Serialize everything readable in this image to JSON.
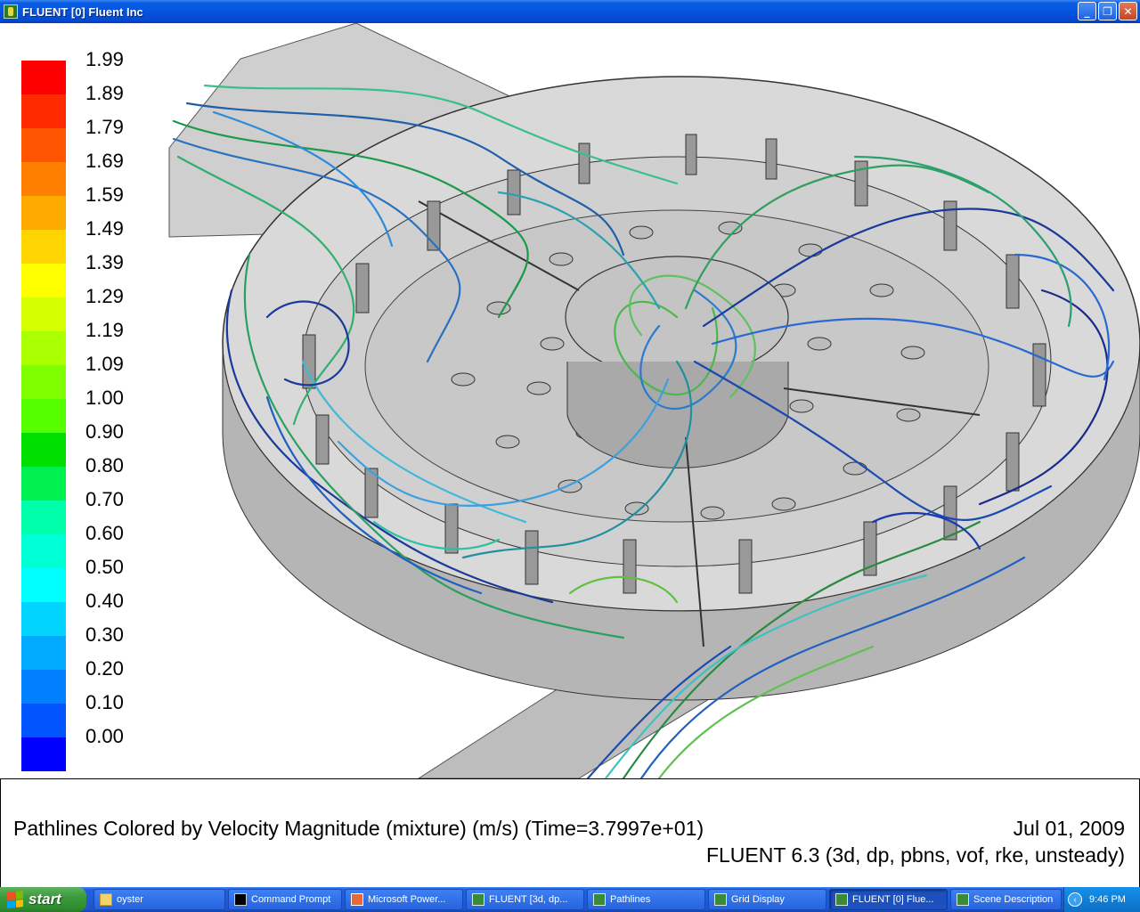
{
  "window": {
    "title": "FLUENT [0] Fluent Inc",
    "controls": [
      "minimize-icon",
      "maximize-icon",
      "close-icon"
    ]
  },
  "colorbar": {
    "labels": [
      "1.99",
      "1.89",
      "1.79",
      "1.69",
      "1.59",
      "1.49",
      "1.39",
      "1.29",
      "1.19",
      "1.09",
      "1.00",
      "0.90",
      "0.80",
      "0.70",
      "0.60",
      "0.50",
      "0.40",
      "0.30",
      "0.20",
      "0.10",
      "0.00"
    ],
    "colors": [
      "#ff0000",
      "#ff2a00",
      "#ff5500",
      "#ff7f00",
      "#ffaa00",
      "#ffd400",
      "#ffff00",
      "#d4ff00",
      "#aaff00",
      "#7fff00",
      "#55ff00",
      "#00e000",
      "#00f04f",
      "#00ffaa",
      "#00ffd4",
      "#00ffff",
      "#00d4ff",
      "#00aaff",
      "#007fff",
      "#0055ff",
      "#0000ff"
    ]
  },
  "caption": {
    "description": "Pathlines Colored by Velocity Magnitude (mixture)  (m/s)  (Time=3.7997e+01)",
    "date": "Jul 01, 2009",
    "version": "FLUENT 6.3 (3d, dp, pbns, vof, rke, unsteady)"
  },
  "taskbar": {
    "start_label": "start",
    "tasks": [
      {
        "label": "oyster",
        "icon": "folder-icon"
      },
      {
        "label": "Command Prompt",
        "icon": "cmd-icon"
      },
      {
        "label": "Microsoft Power...",
        "icon": "powerpoint-icon"
      },
      {
        "label": "FLUENT  [3d, dp...",
        "icon": "fluent-icon"
      },
      {
        "label": "Pathlines",
        "icon": "fluent-icon"
      },
      {
        "label": "Grid Display",
        "icon": "fluent-icon"
      },
      {
        "label": "FLUENT [0] Flue...",
        "icon": "fluent-icon",
        "active": true
      },
      {
        "label": "Scene Description",
        "icon": "fluent-icon"
      }
    ],
    "clock": "9:46 PM"
  }
}
